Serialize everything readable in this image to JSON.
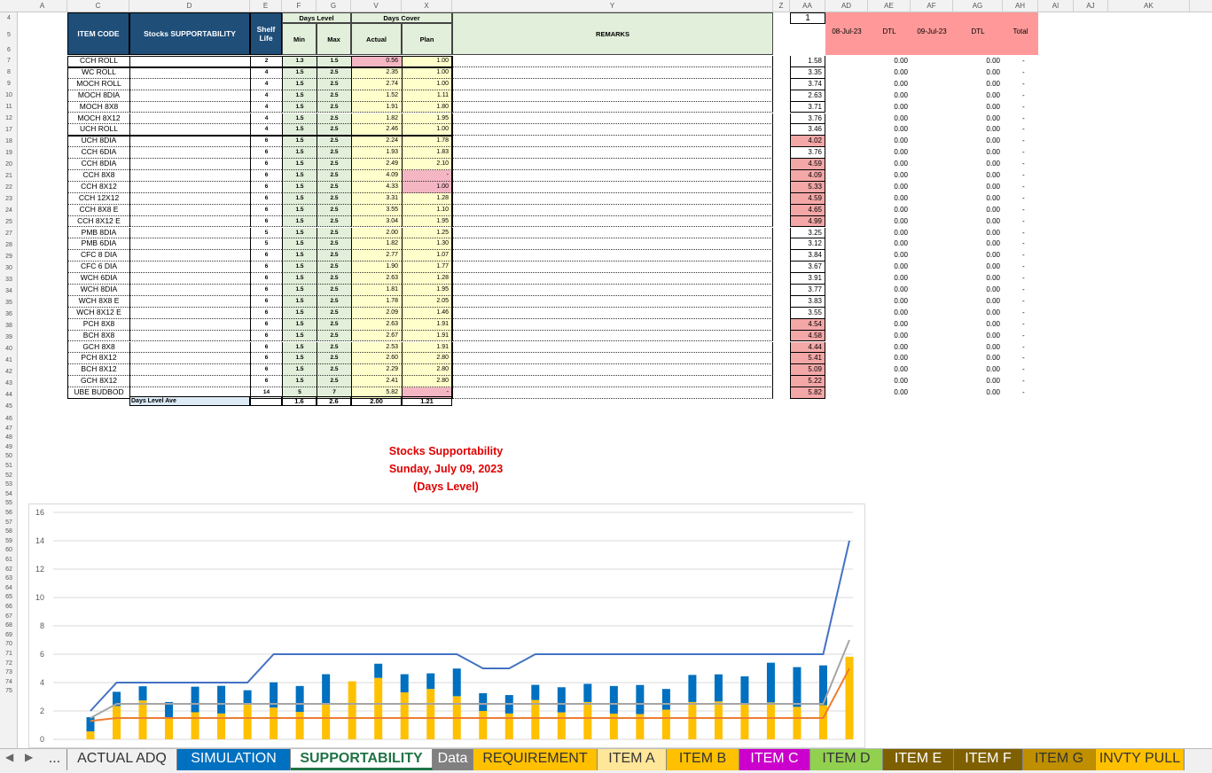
{
  "columns": [
    "A",
    "C",
    "D",
    "E",
    "F",
    "G",
    "V",
    "X",
    "Y",
    "Z",
    "AA",
    "AD",
    "AE",
    "AF",
    "AG",
    "AH",
    "AI",
    "AJ",
    "AK"
  ],
  "rows_visible": [
    "4",
    "5",
    "6",
    "7",
    "8",
    "9",
    "10",
    "11",
    "12",
    "17",
    "18",
    "19",
    "20",
    "21",
    "22",
    "23",
    "24",
    "25",
    "27",
    "28",
    "29",
    "30",
    "33",
    "34",
    "35",
    "36",
    "38",
    "39",
    "40",
    "41",
    "42",
    "43",
    "44",
    "45",
    "46",
    "47",
    "48",
    "49",
    "50",
    "51",
    "52",
    "53",
    "54",
    "55",
    "56",
    "57",
    "58",
    "59",
    "60",
    "61",
    "62",
    "63",
    "64",
    "65",
    "66",
    "67",
    "68",
    "69",
    "70",
    "71",
    "72",
    "73",
    "74",
    "75"
  ],
  "header": {
    "item_code": "ITEM CODE",
    "supportability": "Stocks SUPPORTABILITY",
    "shelf_life": "Shelf Life",
    "days_level": "Days Level",
    "min": "Min",
    "max": "Max",
    "days_cover": "Days Cover",
    "actual": "Actual",
    "plan": "Plan",
    "remarks": "REMARKS",
    "aa_top": "1",
    "ad": "08-Jul-23",
    "ae": "DTL",
    "af": "09-Jul-23",
    "ag": "DTL",
    "ah": "Total"
  },
  "items": [
    {
      "code": "CCH ROLL",
      "shelf": "2",
      "min": "1.3",
      "max": "1.5",
      "actual": "0.56",
      "plan": "1.00",
      "aa": "1.58",
      "ae": "0.00",
      "ag": "0.00",
      "ah": "-",
      "act_red": true,
      "plan_red": false,
      "aa_red": false
    },
    {
      "code": "WC ROLL",
      "shelf": "4",
      "min": "1.5",
      "max": "2.5",
      "actual": "2.35",
      "plan": "1.00",
      "aa": "3.35",
      "ae": "0.00",
      "ag": "0.00",
      "ah": "-",
      "act_red": false,
      "plan_red": false,
      "aa_red": false
    },
    {
      "code": "MOCH ROLL",
      "shelf": "4",
      "min": "1.5",
      "max": "2.5",
      "actual": "2.74",
      "plan": "1.00",
      "aa": "3.74",
      "ae": "0.00",
      "ag": "0.00",
      "ah": "-",
      "act_red": false,
      "plan_red": false,
      "aa_red": false
    },
    {
      "code": "MOCH 8DIA",
      "shelf": "4",
      "min": "1.5",
      "max": "2.5",
      "actual": "1.52",
      "plan": "1.11",
      "aa": "2.63",
      "ae": "0.00",
      "ag": "0.00",
      "ah": "-",
      "act_red": false,
      "plan_red": false,
      "aa_red": false
    },
    {
      "code": "MOCH 8X8",
      "shelf": "4",
      "min": "1.5",
      "max": "2.5",
      "actual": "1.91",
      "plan": "1.80",
      "aa": "3.71",
      "ae": "0.00",
      "ag": "0.00",
      "ah": "-",
      "act_red": false,
      "plan_red": false,
      "aa_red": false
    },
    {
      "code": "MOCH 8X12",
      "shelf": "4",
      "min": "1.5",
      "max": "2.5",
      "actual": "1.82",
      "plan": "1.95",
      "aa": "3.76",
      "ae": "0.00",
      "ag": "0.00",
      "ah": "-",
      "act_red": false,
      "plan_red": false,
      "aa_red": false
    },
    {
      "code": "UCH ROLL",
      "shelf": "4",
      "min": "1.5",
      "max": "2.5",
      "actual": "2.46",
      "plan": "1.00",
      "aa": "3.46",
      "ae": "0.00",
      "ag": "0.00",
      "ah": "-",
      "act_red": false,
      "plan_red": false,
      "aa_red": false
    },
    {
      "code": "UCH 8DIA",
      "shelf": "6",
      "min": "1.5",
      "max": "2.5",
      "actual": "2.24",
      "plan": "1.78",
      "aa": "4.02",
      "ae": "0.00",
      "ag": "0.00",
      "ah": "-",
      "act_red": false,
      "plan_red": false,
      "aa_red": true
    },
    {
      "code": "CCH 6DIA",
      "shelf": "6",
      "min": "1.5",
      "max": "2.5",
      "actual": "1.93",
      "plan": "1.83",
      "aa": "3.76",
      "ae": "0.00",
      "ag": "0.00",
      "ah": "-",
      "act_red": false,
      "plan_red": false,
      "aa_red": false
    },
    {
      "code": "CCH 8DIA",
      "shelf": "6",
      "min": "1.5",
      "max": "2.5",
      "actual": "2.49",
      "plan": "2.10",
      "aa": "4.59",
      "ae": "0.00",
      "ag": "0.00",
      "ah": "-",
      "act_red": false,
      "plan_red": false,
      "aa_red": true
    },
    {
      "code": "CCH  8X8",
      "shelf": "6",
      "min": "1.5",
      "max": "2.5",
      "actual": "4.09",
      "plan": "-",
      "aa": "4.09",
      "ae": "0.00",
      "ag": "0.00",
      "ah": "-",
      "act_red": false,
      "plan_red": true,
      "aa_red": true
    },
    {
      "code": "CCH  8X12",
      "shelf": "6",
      "min": "1.5",
      "max": "2.5",
      "actual": "4.33",
      "plan": "1.00",
      "aa": "5.33",
      "ae": "0.00",
      "ag": "0.00",
      "ah": "-",
      "act_red": false,
      "plan_red": true,
      "aa_red": true
    },
    {
      "code": "CCH 12X12",
      "shelf": "6",
      "min": "1.5",
      "max": "2.5",
      "actual": "3.31",
      "plan": "1.28",
      "aa": "4.59",
      "ae": "0.00",
      "ag": "0.00",
      "ah": "-",
      "act_red": false,
      "plan_red": false,
      "aa_red": true
    },
    {
      "code": "CCH 8X8 E",
      "shelf": "6",
      "min": "1.5",
      "max": "2.5",
      "actual": "3.55",
      "plan": "1.10",
      "aa": "4.65",
      "ae": "0.00",
      "ag": "0.00",
      "ah": "-",
      "act_red": false,
      "plan_red": false,
      "aa_red": true
    },
    {
      "code": "CCH 8X12 E",
      "shelf": "6",
      "min": "1.5",
      "max": "2.5",
      "actual": "3.04",
      "plan": "1.95",
      "aa": "4.99",
      "ae": "0.00",
      "ag": "0.00",
      "ah": "-",
      "act_red": false,
      "plan_red": false,
      "aa_red": true
    },
    {
      "code": "PMB 8DIA",
      "shelf": "5",
      "min": "1.5",
      "max": "2.5",
      "actual": "2.00",
      "plan": "1.25",
      "aa": "3.25",
      "ae": "0.00",
      "ag": "0.00",
      "ah": "-",
      "act_red": false,
      "plan_red": false,
      "aa_red": false
    },
    {
      "code": "PMB 6DIA",
      "shelf": "5",
      "min": "1.5",
      "max": "2.5",
      "actual": "1.82",
      "plan": "1.30",
      "aa": "3.12",
      "ae": "0.00",
      "ag": "0.00",
      "ah": "-",
      "act_red": false,
      "plan_red": false,
      "aa_red": false
    },
    {
      "code": "CFC 8 DIA",
      "shelf": "6",
      "min": "1.5",
      "max": "2.5",
      "actual": "2.77",
      "plan": "1.07",
      "aa": "3.84",
      "ae": "0.00",
      "ag": "0.00",
      "ah": "-",
      "act_red": false,
      "plan_red": false,
      "aa_red": false
    },
    {
      "code": "CFC 6 DIA",
      "shelf": "6",
      "min": "1.5",
      "max": "2.5",
      "actual": "1.90",
      "plan": "1.77",
      "aa": "3.67",
      "ae": "0.00",
      "ag": "0.00",
      "ah": "-",
      "act_red": false,
      "plan_red": false,
      "aa_red": false
    },
    {
      "code": "WCH 6DIA",
      "shelf": "6",
      "min": "1.5",
      "max": "2.5",
      "actual": "2.63",
      "plan": "1.28",
      "aa": "3.91",
      "ae": "0.00",
      "ag": "0.00",
      "ah": "-",
      "act_red": false,
      "plan_red": false,
      "aa_red": false
    },
    {
      "code": "WCH 8DIA",
      "shelf": "6",
      "min": "1.5",
      "max": "2.5",
      "actual": "1.81",
      "plan": "1.95",
      "aa": "3.77",
      "ae": "0.00",
      "ag": "0.00",
      "ah": "-",
      "act_red": false,
      "plan_red": false,
      "aa_red": false
    },
    {
      "code": "WCH 8X8 E",
      "shelf": "6",
      "min": "1.5",
      "max": "2.5",
      "actual": "1.78",
      "plan": "2.05",
      "aa": "3.83",
      "ae": "0.00",
      "ag": "0.00",
      "ah": "-",
      "act_red": false,
      "plan_red": false,
      "aa_red": false
    },
    {
      "code": "WCH 8X12 E",
      "shelf": "6",
      "min": "1.5",
      "max": "2.5",
      "actual": "2.09",
      "plan": "1.46",
      "aa": "3.55",
      "ae": "0.00",
      "ag": "0.00",
      "ah": "-",
      "act_red": false,
      "plan_red": false,
      "aa_red": false
    },
    {
      "code": "PCH 8X8",
      "shelf": "6",
      "min": "1.5",
      "max": "2.5",
      "actual": "2.63",
      "plan": "1.91",
      "aa": "4.54",
      "ae": "0.00",
      "ag": "0.00",
      "ah": "-",
      "act_red": false,
      "plan_red": false,
      "aa_red": true
    },
    {
      "code": "BCH 8X8",
      "shelf": "6",
      "min": "1.5",
      "max": "2.5",
      "actual": "2.67",
      "plan": "1.91",
      "aa": "4.58",
      "ae": "0.00",
      "ag": "0.00",
      "ah": "-",
      "act_red": false,
      "plan_red": false,
      "aa_red": true
    },
    {
      "code": "GCH 8X8",
      "shelf": "6",
      "min": "1.5",
      "max": "2.5",
      "actual": "2.53",
      "plan": "1.91",
      "aa": "4.44",
      "ae": "0.00",
      "ag": "0.00",
      "ah": "-",
      "act_red": false,
      "plan_red": false,
      "aa_red": true
    },
    {
      "code": "PCH 8X12",
      "shelf": "6",
      "min": "1.5",
      "max": "2.5",
      "actual": "2.60",
      "plan": "2.80",
      "aa": "5.41",
      "ae": "0.00",
      "ag": "0.00",
      "ah": "-",
      "act_red": false,
      "plan_red": false,
      "aa_red": true
    },
    {
      "code": "BCH 8X12",
      "shelf": "6",
      "min": "1.5",
      "max": "2.5",
      "actual": "2.29",
      "plan": "2.80",
      "aa": "5.09",
      "ae": "0.00",
      "ag": "0.00",
      "ah": "-",
      "act_red": false,
      "plan_red": false,
      "aa_red": true
    },
    {
      "code": "GCH 8X12",
      "shelf": "6",
      "min": "1.5",
      "max": "2.5",
      "actual": "2.41",
      "plan": "2.80",
      "aa": "5.22",
      "ae": "0.00",
      "ag": "0.00",
      "ah": "-",
      "act_red": false,
      "plan_red": false,
      "aa_red": true
    },
    {
      "code": "UBE BUDBOD",
      "shelf": "14",
      "min": "5",
      "max": "7",
      "actual": "5.82",
      "plan": "-",
      "aa": "5.82",
      "ae": "0.00",
      "ag": "0.00",
      "ah": "-",
      "act_red": false,
      "plan_red": true,
      "aa_red": true
    }
  ],
  "footer": {
    "label": "Days Level Ave",
    "min": "1.6",
    "max": "2.6",
    "actual": "2.00",
    "plan": "1.21"
  },
  "chart_title": [
    "Stocks Supportability",
    "Sunday, July 09, 2023",
    "(Days Level)"
  ],
  "chart_data": {
    "type": "bar",
    "title": "Stocks Supportability Sunday, July 09, 2023 (Days Level)",
    "ylim": [
      0,
      16
    ],
    "yticks": [
      "0",
      "2",
      "4",
      "6",
      "8",
      "10",
      "12",
      "14",
      "16"
    ],
    "grid": true,
    "stacked": true,
    "series": [
      {
        "color": "#ffc000",
        "values": [
          0.56,
          2.35,
          2.74,
          1.52,
          1.91,
          1.82,
          2.46,
          2.24,
          1.93,
          2.49,
          4.09,
          4.33,
          3.31,
          3.55,
          3.04,
          2.0,
          1.82,
          2.77,
          1.9,
          2.63,
          1.81,
          1.78,
          2.09,
          2.63,
          2.67,
          2.53,
          2.6,
          2.29,
          2.41,
          5.82
        ]
      },
      {
        "color": "#0070c0",
        "values": [
          1.0,
          1.0,
          1.0,
          1.11,
          1.8,
          1.95,
          1.0,
          1.78,
          1.83,
          2.1,
          0,
          1.0,
          1.28,
          1.1,
          1.95,
          1.25,
          1.3,
          1.07,
          1.77,
          1.28,
          1.95,
          2.05,
          1.46,
          1.91,
          1.91,
          1.91,
          2.8,
          2.8,
          2.8,
          0
        ]
      },
      {
        "type": "line",
        "color": "#4472c4",
        "values": [
          2,
          4,
          4,
          4,
          4,
          4,
          4,
          6,
          6,
          6,
          6,
          6,
          6,
          6,
          6,
          5,
          5,
          6,
          6,
          6,
          6,
          6,
          6,
          6,
          6,
          6,
          6,
          6,
          6,
          14
        ]
      },
      {
        "type": "line",
        "color": "#a5a5a5",
        "values": [
          1.5,
          2.5,
          2.5,
          2.5,
          2.5,
          2.5,
          2.5,
          2.5,
          2.5,
          2.5,
          2.5,
          2.5,
          2.5,
          2.5,
          2.5,
          2.5,
          2.5,
          2.5,
          2.5,
          2.5,
          2.5,
          2.5,
          2.5,
          2.5,
          2.5,
          2.5,
          2.5,
          2.5,
          2.5,
          7
        ]
      },
      {
        "type": "line",
        "color": "#ed7d31",
        "values": [
          1.3,
          1.5,
          1.5,
          1.5,
          1.5,
          1.5,
          1.5,
          1.5,
          1.5,
          1.5,
          1.5,
          1.5,
          1.5,
          1.5,
          1.5,
          1.5,
          1.5,
          1.5,
          1.5,
          1.5,
          1.5,
          1.5,
          1.5,
          1.5,
          1.5,
          1.5,
          1.5,
          1.5,
          1.5,
          5
        ]
      }
    ]
  },
  "tabs": [
    {
      "label": "...",
      "bg": "#f0f0f0",
      "fg": "#333"
    },
    {
      "label": "ACTUAL ADQ",
      "bg": "#f0f0f0",
      "fg": "#333"
    },
    {
      "label": "SIMULATION",
      "bg": "#0070c0",
      "fg": "#ffffff"
    },
    {
      "label": "SUPPORTABILITY",
      "bg": "#ffffff",
      "fg": "#217346",
      "active": true
    },
    {
      "label": "Data",
      "bg": "#808080",
      "fg": "#ffffff"
    },
    {
      "label": "REQUIREMENT",
      "bg": "#ffc000",
      "fg": "#333"
    },
    {
      "label": "ITEM A",
      "bg": "#ffe699",
      "fg": "#333"
    },
    {
      "label": "ITEM B",
      "bg": "#ffc000",
      "fg": "#333"
    },
    {
      "label": "ITEM C",
      "bg": "#cc00cc",
      "fg": "#ffffff"
    },
    {
      "label": "ITEM D",
      "bg": "#92d050",
      "fg": "#333"
    },
    {
      "label": "ITEM E",
      "bg": "#7f6000",
      "fg": "#ffffff"
    },
    {
      "label": "ITEM F",
      "bg": "#7f6000",
      "fg": "#ffffff"
    },
    {
      "label": "ITEM G",
      "bg": "#bf8f00",
      "fg": "#333"
    },
    {
      "label": "INVTY PULL",
      "bg": "#ffc000",
      "fg": "#333"
    }
  ]
}
